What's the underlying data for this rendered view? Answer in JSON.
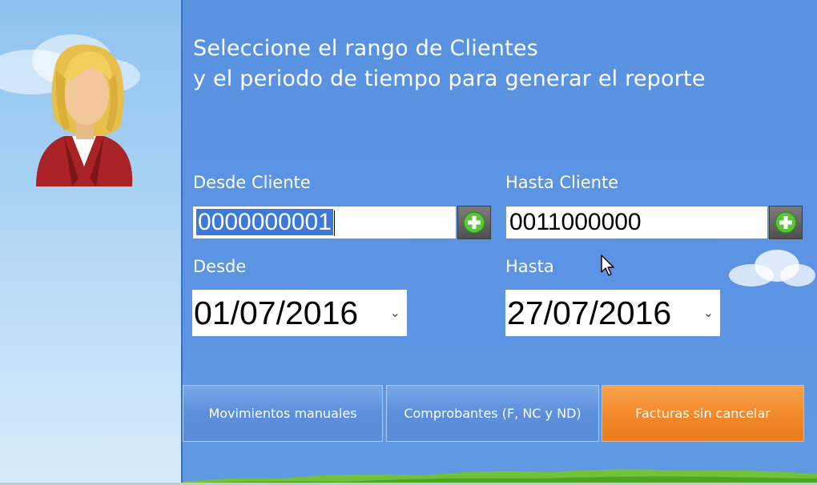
{
  "heading": {
    "line1": "Seleccione el rango de Clientes",
    "line2": "y el periodo de tiempo para generar el reporte"
  },
  "desde_cliente": {
    "label": "Desde Cliente",
    "value": "0000000001",
    "icon": "plus-icon"
  },
  "hasta_cliente": {
    "label": "Hasta Cliente",
    "value": "0011000000",
    "icon": "plus-icon"
  },
  "desde": {
    "label": "Desde",
    "value": "01/07/2016",
    "icon": "chevron-down-icon"
  },
  "hasta": {
    "label": "Hasta",
    "value": "27/07/2016",
    "icon": "chevron-down-icon"
  },
  "buttons": {
    "movimientos": "Movimientos manuales",
    "comprobantes": "Comprobantes (F, NC y ND)",
    "facturas": "Facturas sin cancelar"
  },
  "colors": {
    "background": "#5b93e0",
    "accent_orange": "#f38a2b",
    "selection": "#3d79d8"
  }
}
